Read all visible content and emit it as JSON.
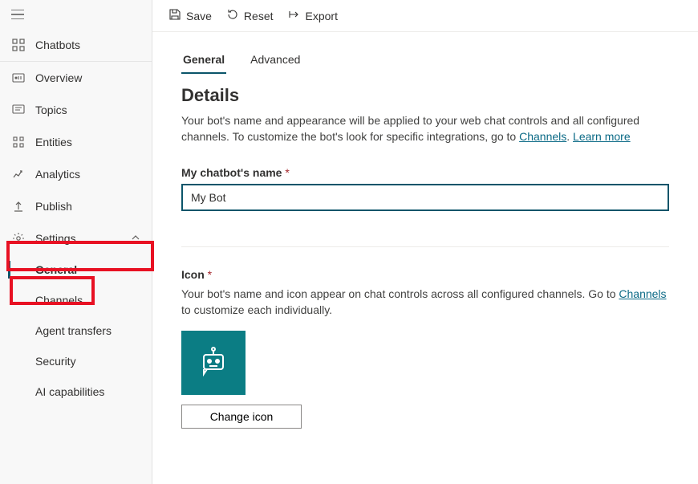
{
  "toolbar": {
    "save": "Save",
    "reset": "Reset",
    "export": "Export"
  },
  "sidebar": {
    "top": {
      "label": "Chatbots"
    },
    "items": [
      {
        "label": "Overview"
      },
      {
        "label": "Topics"
      },
      {
        "label": "Entities"
      },
      {
        "label": "Analytics"
      },
      {
        "label": "Publish"
      }
    ],
    "settings": {
      "label": "Settings"
    },
    "subitems": [
      {
        "label": "General"
      },
      {
        "label": "Channels"
      },
      {
        "label": "Agent transfers"
      },
      {
        "label": "Security"
      },
      {
        "label": "AI capabilities"
      }
    ]
  },
  "tabs": {
    "general": "General",
    "advanced": "Advanced"
  },
  "details": {
    "heading": "Details",
    "desc_part1": "Your bot's name and appearance will be applied to your web chat controls and all configured channels. To customize the bot's look for specific integrations, go to ",
    "channels_link": "Channels",
    "desc_part2": ". ",
    "learn_more": "Learn more",
    "name_label": "My chatbot's name",
    "name_value": "My Bot",
    "icon_label": "Icon",
    "icon_desc_part1": "Your bot's name and icon appear on chat controls across all configured channels. Go to ",
    "icon_desc_part2": " to customize each individually.",
    "change_icon": "Change icon"
  }
}
